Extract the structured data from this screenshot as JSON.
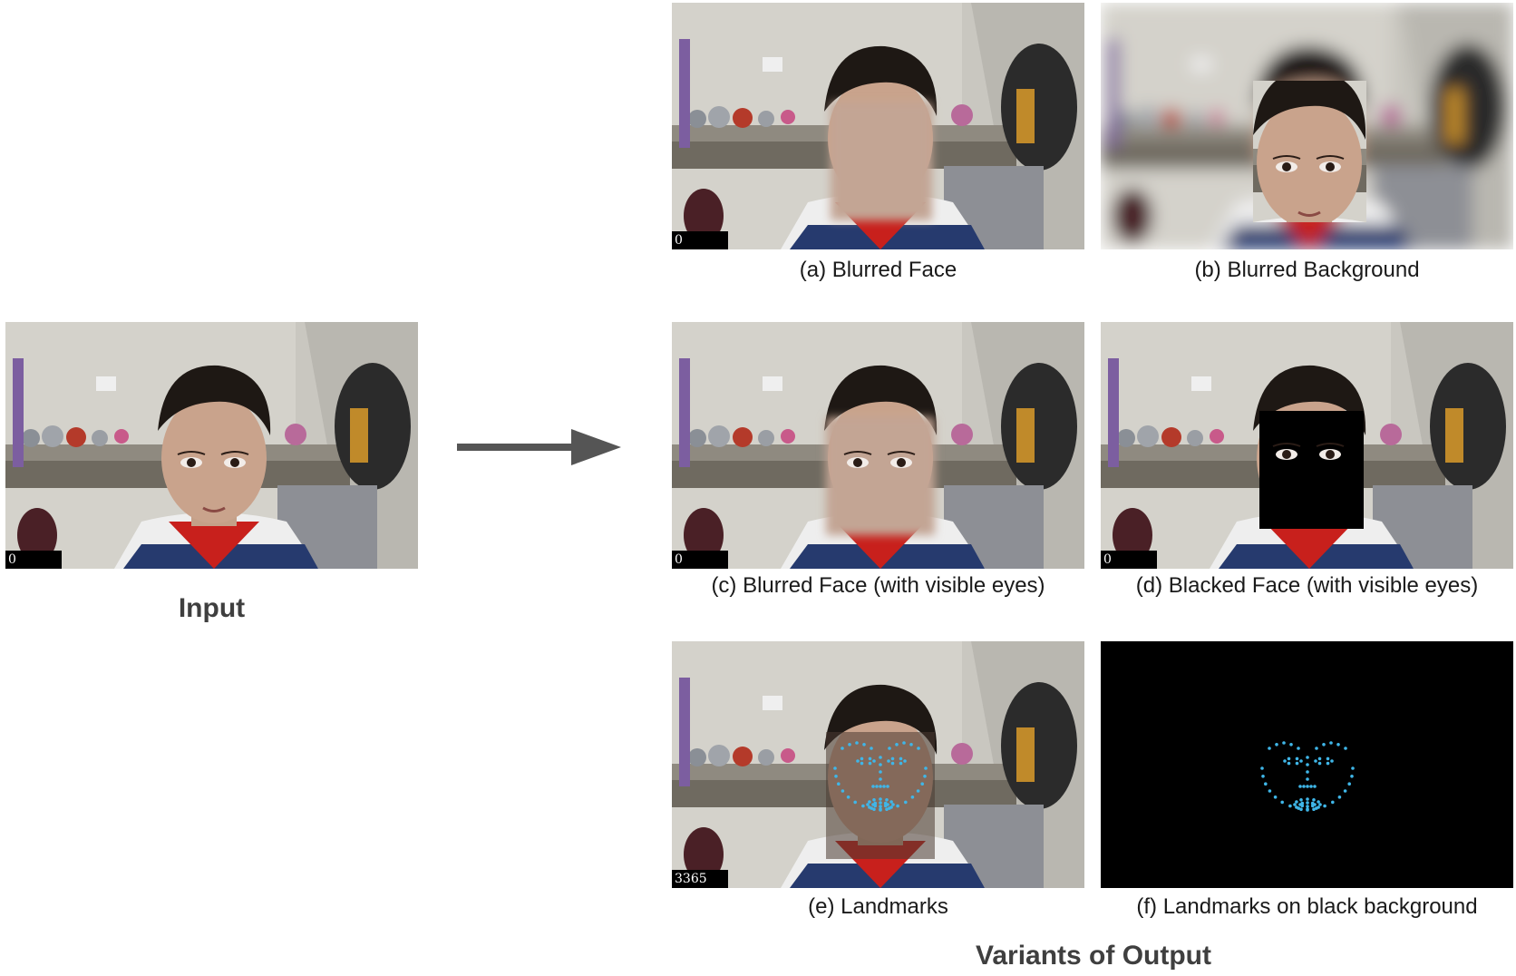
{
  "input": {
    "label": "Input",
    "counter": "0"
  },
  "output_group": {
    "label": "Variants of Output"
  },
  "variants": [
    {
      "caption": "(a) Blurred Face",
      "counter": "0"
    },
    {
      "caption": "(b) Blurred Background",
      "counter": ""
    },
    {
      "caption": "(c) Blurred Face (with visible eyes)",
      "counter": "0"
    },
    {
      "caption": "(d) Blacked Face (with visible eyes)",
      "counter": "0"
    },
    {
      "caption": "(e) Landmarks",
      "counter": "3365"
    },
    {
      "caption": "(f) Landmarks on black background",
      "counter": ""
    }
  ],
  "colors": {
    "landmark": "#3fb6e8",
    "arrow": "#555555"
  }
}
